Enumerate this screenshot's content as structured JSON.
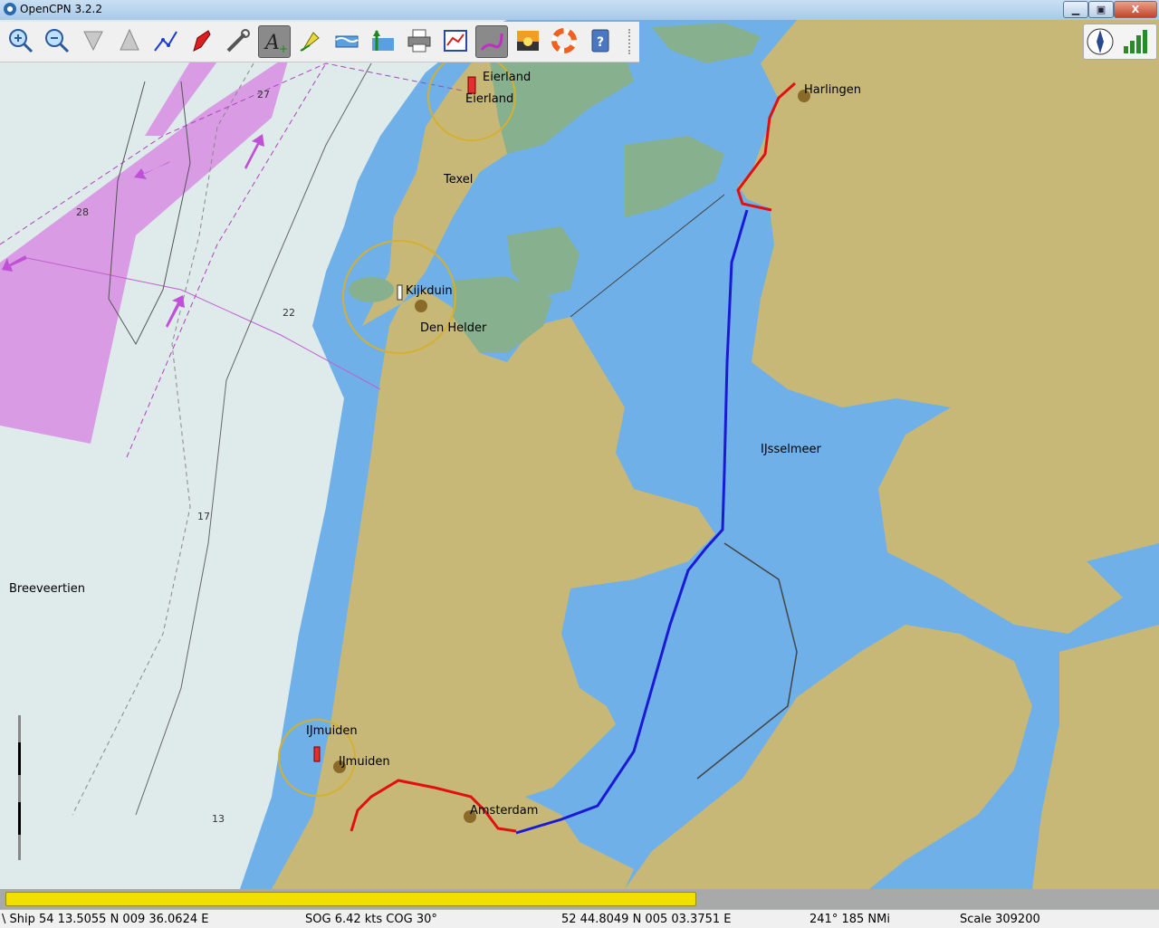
{
  "window": {
    "title": "OpenCPN 3.2.2",
    "minimize": "▁",
    "maximize": "▣",
    "close": "X"
  },
  "toolbar": {
    "tools": [
      {
        "name": "zoom-in",
        "icon": "zoom-in-icon"
      },
      {
        "name": "zoom-out",
        "icon": "zoom-out-icon"
      },
      {
        "name": "scale-in",
        "icon": "scale-in-icon"
      },
      {
        "name": "scale-out",
        "icon": "scale-out-icon"
      },
      {
        "name": "route",
        "icon": "route-icon"
      },
      {
        "name": "follow",
        "icon": "follow-ship-icon"
      },
      {
        "name": "settings",
        "icon": "settings-icon"
      },
      {
        "name": "text",
        "icon": "text-icon",
        "active": true
      },
      {
        "name": "current",
        "icon": "current-icon"
      },
      {
        "name": "tide",
        "icon": "tide-icon"
      },
      {
        "name": "tide2",
        "icon": "tide2-icon"
      },
      {
        "name": "print",
        "icon": "print-icon"
      },
      {
        "name": "route-manager",
        "icon": "route-manager-icon"
      },
      {
        "name": "track",
        "icon": "track-icon",
        "active": true
      },
      {
        "name": "color-scheme",
        "icon": "color-scheme-icon"
      },
      {
        "name": "mob",
        "icon": "man-overboard-icon"
      },
      {
        "name": "help",
        "icon": "help-icon"
      }
    ]
  },
  "map_labels": {
    "eierland1": "Eierland",
    "eierland2": "Eierland",
    "texel": "Texel",
    "kijkduin": "Kijkduin",
    "den_helder": "Den Helder",
    "harlingen": "Harlingen",
    "ijsselmeer": "IJsselmeer",
    "breeveertien": "Breeveertien",
    "ijmuiden1": "IJmuiden",
    "ijmuiden2": "IJmuiden",
    "amsterdam": "Amsterdam"
  },
  "depths": {
    "d27": "27",
    "d28": "28",
    "d22": "22",
    "d17": "17",
    "d13": "13"
  },
  "progress": {
    "fraction": 0.6
  },
  "status": {
    "ship": "\\ Ship 54 13.5055 N   009 36.0624 E",
    "sog_cog": "SOG 6.42 kts   COG 30°",
    "cursor": "52 44.8049 N   005 03.3751 E",
    "bearing_dist": "241°   185 NMi",
    "scale": "Scale 309200"
  },
  "colors": {
    "land": "#c8b878",
    "shallow": "#6fb0e8",
    "deep": "#dfeaea",
    "marsh": "#86b08e",
    "traffic": "#d89be4",
    "route": "#1a1ad6",
    "track": "#e01010"
  }
}
